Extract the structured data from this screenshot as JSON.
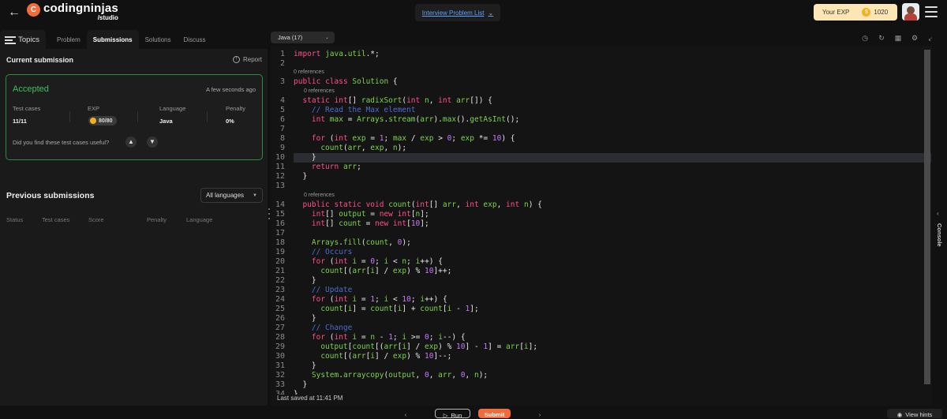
{
  "header": {
    "back_icon": "arrow-left-icon",
    "logo_mark": "C",
    "logo_name": "codingninjas",
    "logo_sub": "/studio",
    "problem_list": "Interview Problem List",
    "exp_label": "Your EXP",
    "exp_value": "1020"
  },
  "left": {
    "tabs": [
      "Topics",
      "Problem",
      "Submissions",
      "Solutions",
      "Discuss"
    ],
    "active_tab": "Submissions",
    "current_title": "Current submission",
    "report": "Report",
    "card": {
      "status": "Accepted",
      "time": "A few seconds ago",
      "test_cases_label": "Test cases",
      "test_cases_value": "11/11",
      "exp_label": "EXP",
      "exp_value": "80/80",
      "language_label": "Language",
      "language_value": "Java",
      "penalty_label": "Penalty",
      "penalty_value": "0%",
      "useful_q": "Did you find these test cases useful?"
    },
    "previous_title": "Previous submissions",
    "lang_filter": "All languages",
    "columns": [
      "Status",
      "Test cases",
      "Score",
      "Penalty",
      "Language"
    ]
  },
  "editor": {
    "language": "Java (17)",
    "refs": "0 references",
    "saved": "Last saved at 11:41 PM"
  },
  "console": {
    "label": "Console"
  },
  "bottom": {
    "run": "Run",
    "submit": "Submit",
    "hints": "View hints"
  },
  "colors": {
    "accent": "#f26b3a",
    "accepted": "#3fbf5f",
    "link": "#5ea2ff",
    "keyword": "#ff4f8b",
    "number": "#c679ff",
    "comment": "#4d6bd0",
    "identifier": "#7fd24a"
  }
}
